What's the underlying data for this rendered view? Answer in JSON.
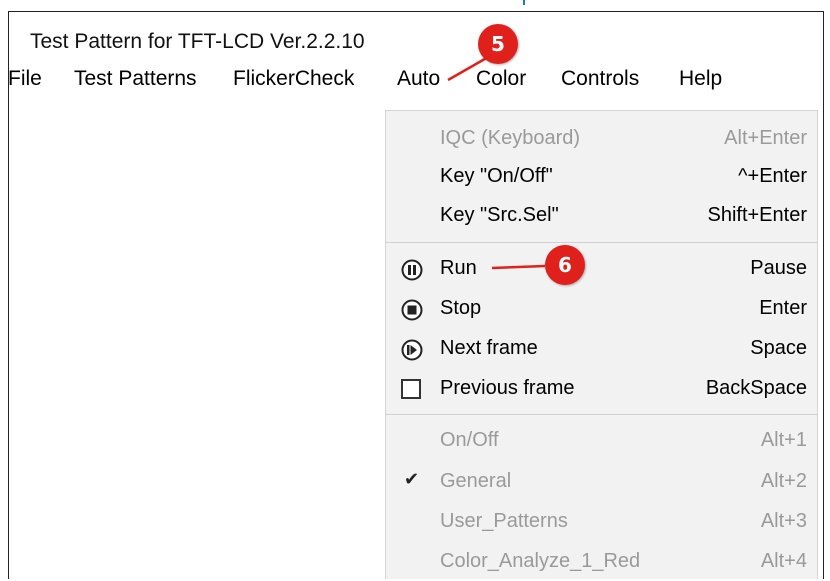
{
  "window": {
    "title": "Test Pattern for TFT-LCD Ver.2.2.10"
  },
  "menubar": {
    "items": [
      {
        "label": "File"
      },
      {
        "label": "Test Patterns"
      },
      {
        "label": "FlickerCheck"
      },
      {
        "label": "Auto"
      },
      {
        "label": "Color"
      },
      {
        "label": "Controls"
      },
      {
        "label": "Help"
      }
    ]
  },
  "auto_menu": {
    "group1": [
      {
        "label": "IQC (Keyboard)",
        "shortcut": "Alt+Enter",
        "enabled": false
      },
      {
        "label": "Key \"On/Off\"",
        "shortcut": "^+Enter",
        "enabled": true
      },
      {
        "label": "Key \"Src.Sel\"",
        "shortcut": "Shift+Enter",
        "enabled": true
      }
    ],
    "group2": [
      {
        "label": "Run",
        "shortcut": "Pause",
        "icon": "pause-icon"
      },
      {
        "label": "Stop",
        "shortcut": "Enter",
        "icon": "stop-icon"
      },
      {
        "label": "Next frame",
        "shortcut": "Space",
        "icon": "next-frame-icon"
      },
      {
        "label": "Previous frame",
        "shortcut": "BackSpace",
        "icon": "checkbox-icon"
      }
    ],
    "group3": [
      {
        "label": "On/Off",
        "shortcut": "Alt+1",
        "checked": false
      },
      {
        "label": "General",
        "shortcut": "Alt+2",
        "checked": true
      },
      {
        "label": "User_Patterns",
        "shortcut": "Alt+3",
        "checked": false
      },
      {
        "label": "Color_Analyze_1_Red",
        "shortcut": "Alt+4",
        "checked": false
      }
    ]
  },
  "annotations": {
    "step5": "5",
    "step6": "6",
    "color": "#e0201b"
  }
}
